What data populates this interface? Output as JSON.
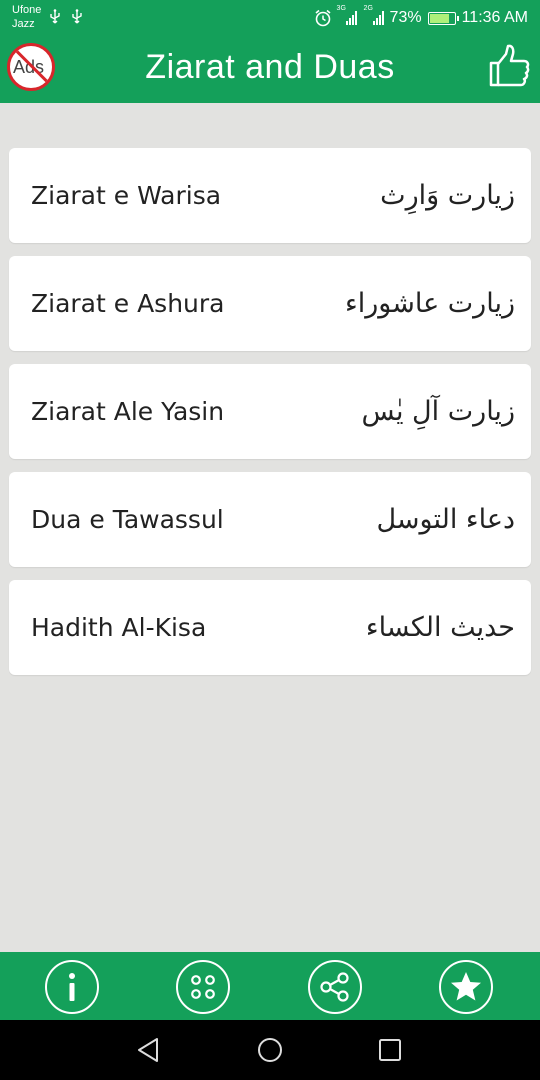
{
  "status_bar": {
    "carrier_line1": "Ufone",
    "carrier_line2": "Jazz",
    "network_1": "3G",
    "network_2": "2G",
    "battery": "73%",
    "battery_level": 0.73,
    "time": "11:36 AM",
    "icons": [
      "usb-icon",
      "usb-icon",
      "alarm-icon",
      "signal-icon",
      "signal-icon",
      "battery-icon"
    ]
  },
  "app_bar": {
    "title": "Ziarat and Duas",
    "left_icon_text": "Ads",
    "left_icon": "no-ads-icon",
    "right_icon": "thumbs-up-icon"
  },
  "items": [
    {
      "english": "Ziarat e Warisa",
      "arabic": "زيارت وَارِث"
    },
    {
      "english": "Ziarat e Ashura",
      "arabic": "زيارت عاشوراء"
    },
    {
      "english": "Ziarat Ale Yasin",
      "arabic": "زيارت آلِ يٰس"
    },
    {
      "english": "Dua e Tawassul",
      "arabic": "دعاء التوسل"
    },
    {
      "english": "Hadith Al-Kisa",
      "arabic": "حديث الكساء"
    }
  ],
  "bottom_bar": {
    "buttons": [
      "info-icon",
      "more-apps-icon",
      "share-icon",
      "star-icon"
    ]
  },
  "nav_bar": {
    "buttons": [
      "back-icon",
      "home-icon",
      "recents-icon"
    ]
  },
  "colors": {
    "primary": "#14a05a",
    "background": "#e2e2e0",
    "card": "#ffffff",
    "no_ads_red": "#d8262b"
  }
}
